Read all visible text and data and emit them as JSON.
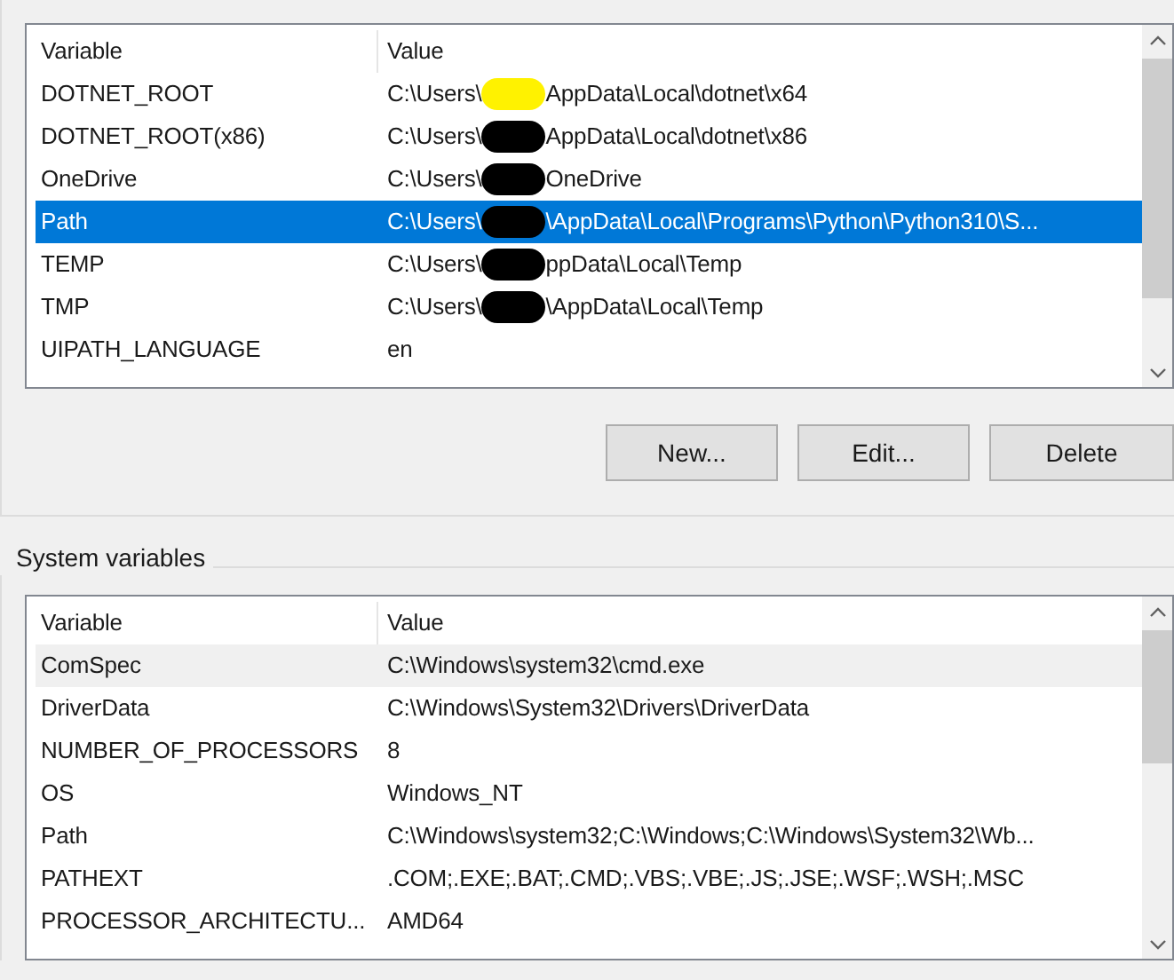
{
  "user_variables": {
    "focused": true,
    "columns": [
      "Variable",
      "Value"
    ],
    "rows": [
      {
        "variable": "DOTNET_ROOT",
        "value_start": "C:\\Users\\",
        "value_end": "AppData\\Local\\dotnet\\x64",
        "color": "#fff200",
        "selected": false
      },
      {
        "variable": "DOTNET_ROOT(x86)",
        "value_start": "C:\\Users\\",
        "value_end": "AppData\\Local\\dotnet\\x86",
        "color": "#000000",
        "selected": false
      },
      {
        "variable": "OneDrive",
        "value_start": "C:\\Users\\",
        "value_end": "OneDrive",
        "color": "#000000",
        "selected": false
      },
      {
        "variable": "Path",
        "value_start": "C:\\Users\\",
        "value_end": "\\AppData\\Local\\Programs\\Python\\Python310\\S...",
        "color": "#000000",
        "selected": true
      },
      {
        "variable": "TEMP",
        "value_start": "C:\\Users\\",
        "value_end": "ppData\\Local\\Temp",
        "color": "#000000",
        "selected": false
      },
      {
        "variable": "TMP",
        "value_start": "C:\\Users\\",
        "value_end": "\\AppData\\Local\\Temp",
        "color": "#000000",
        "selected": false
      },
      {
        "variable": "UIPATH_LANGUAGE",
        "value_start": "en",
        "selected": false
      }
    ]
  },
  "buttons": [
    "New...",
    "Edit...",
    "Delete"
  ],
  "system_variables": {
    "title": "System variables",
    "focused": false,
    "columns": [
      "Variable",
      "Value"
    ],
    "rows": [
      {
        "variable": "ComSpec",
        "value_start": "C:\\Windows\\system32\\cmd.exe",
        "selected": true
      },
      {
        "variable": "DriverData",
        "value_start": "C:\\Windows\\System32\\Drivers\\DriverData",
        "selected": false
      },
      {
        "variable": "NUMBER_OF_PROCESSORS",
        "value_start": "8",
        "selected": false
      },
      {
        "variable": "OS",
        "value_start": "Windows_NT",
        "selected": false
      },
      {
        "variable": "Path",
        "value_start": "C:\\Windows\\system32;C:\\Windows;C:\\Windows\\System32\\Wb...",
        "selected": false
      },
      {
        "variable": "PATHEXT",
        "value_start": ".COM;.EXE;.BAT;.CMD;.VBS;.VBE;.JS;.JSE;.WSF;.WSH;.MSC",
        "selected": false
      },
      {
        "variable": "PROCESSOR_ARCHITECTU...",
        "value_start": "AMD64",
        "selected": false
      }
    ]
  }
}
